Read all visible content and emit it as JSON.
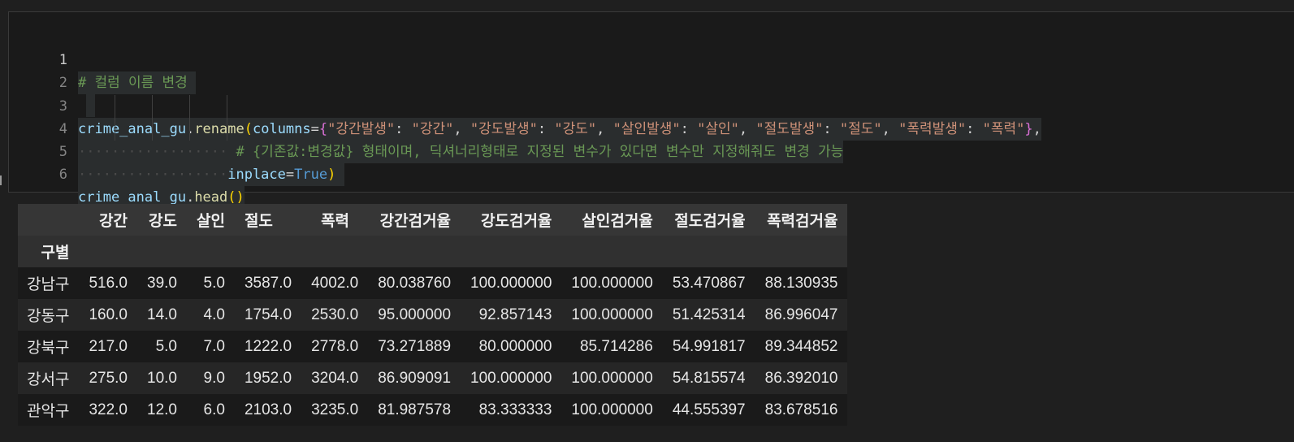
{
  "code_cell": {
    "line_numbers": [
      "1",
      "2",
      "3",
      "4",
      "5",
      "6"
    ],
    "line1": {
      "comment": "# 컬럼 이름 변경"
    },
    "line3": {
      "obj": "crime_anal_gu",
      "dot": ".",
      "method": "rename",
      "open_paren": "(",
      "kwarg": "columns",
      "eq": "=",
      "open_brace": "{",
      "pairs": [
        {
          "key": "\"강간발생\"",
          "val": "\"강간\""
        },
        {
          "key": "\"강도발생\"",
          "val": "\"강도\""
        },
        {
          "key": "\"살인발생\"",
          "val": "\"살인\""
        },
        {
          "key": "\"절도발생\"",
          "val": "\"절도\""
        },
        {
          "key": "\"폭력발생\"",
          "val": "\"폭력\""
        }
      ],
      "colon": ": ",
      "sep": ", ",
      "close_brace": "}",
      "trail": ","
    },
    "line4": {
      "comment": "# {기존값:변경값} 형태이며, 딕셔너리형태로 지정된 변수가 있다면 변수만 지정해줘도 변경 가능"
    },
    "line5": {
      "kwarg": "inplace",
      "eq": "=",
      "value": "True",
      "close_paren": ")"
    },
    "line6": {
      "obj": "crime_anal_gu",
      "dot": ".",
      "method": "head",
      "parens": "()"
    }
  },
  "dataframe": {
    "columns": [
      "강간",
      "강도",
      "살인",
      "절도",
      "폭력",
      "강간검거율",
      "강도검거율",
      "살인검거율",
      "절도검거율",
      "폭력검거율"
    ],
    "index_name": "구별",
    "rows": [
      {
        "index": "강남구",
        "values": [
          "516.0",
          "39.0",
          "5.0",
          "3587.0",
          "4002.0",
          "80.038760",
          "100.000000",
          "100.000000",
          "53.470867",
          "88.130935"
        ]
      },
      {
        "index": "강동구",
        "values": [
          "160.0",
          "14.0",
          "4.0",
          "1754.0",
          "2530.0",
          "95.000000",
          "92.857143",
          "100.000000",
          "51.425314",
          "86.996047"
        ]
      },
      {
        "index": "강북구",
        "values": [
          "217.0",
          "5.0",
          "7.0",
          "1222.0",
          "2778.0",
          "73.271889",
          "80.000000",
          "85.714286",
          "54.991817",
          "89.344852"
        ]
      },
      {
        "index": "강서구",
        "values": [
          "275.0",
          "10.0",
          "9.0",
          "1952.0",
          "3204.0",
          "86.909091",
          "100.000000",
          "100.000000",
          "54.815574",
          "86.392010"
        ]
      },
      {
        "index": "관악구",
        "values": [
          "322.0",
          "12.0",
          "6.0",
          "2103.0",
          "3235.0",
          "81.987578",
          "83.333333",
          "100.000000",
          "44.555397",
          "83.678516"
        ]
      }
    ]
  }
}
